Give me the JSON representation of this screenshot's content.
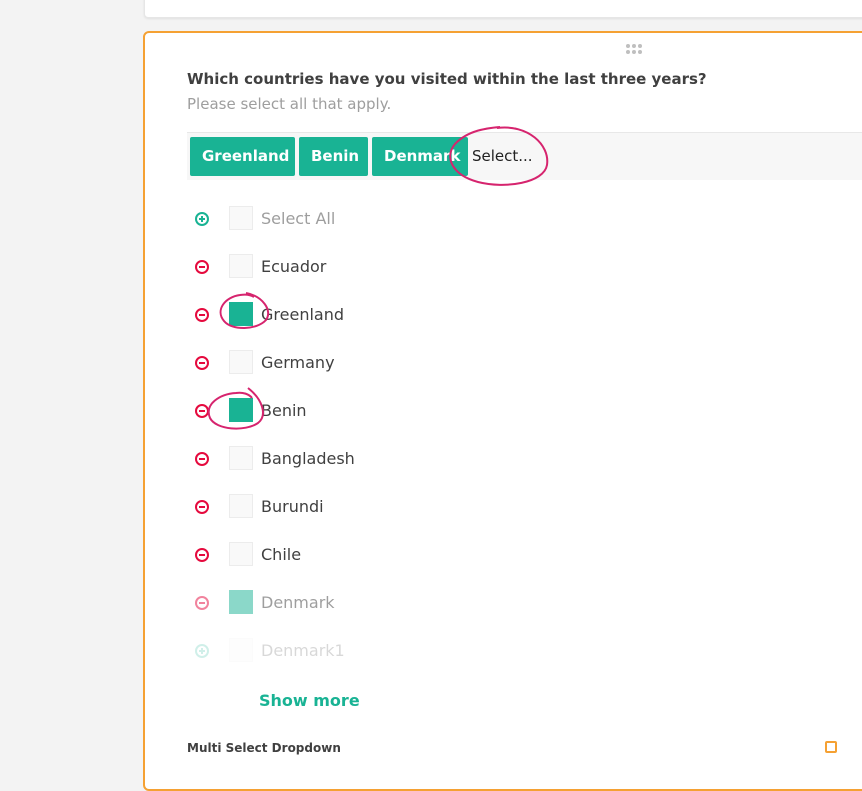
{
  "question": {
    "title": "Which countries have you visited within the last three years?",
    "description": "Please select all that apply."
  },
  "tag_box": {
    "tags": [
      "Greenland",
      "Benin",
      "Denmark"
    ],
    "placeholder": "Select..."
  },
  "options": [
    {
      "label": "Select All",
      "checked": false,
      "action": "add-icon"
    },
    {
      "label": "Ecuador",
      "checked": false,
      "action": "remove-icon"
    },
    {
      "label": "Greenland",
      "checked": true,
      "action": "remove-icon"
    },
    {
      "label": "Germany",
      "checked": false,
      "action": "remove-icon"
    },
    {
      "label": "Benin",
      "checked": true,
      "action": "remove-icon"
    },
    {
      "label": "Bangladesh",
      "checked": false,
      "action": "remove-icon"
    },
    {
      "label": "Burundi",
      "checked": false,
      "action": "remove-icon"
    },
    {
      "label": "Chile",
      "checked": false,
      "action": "remove-icon"
    },
    {
      "label": "Denmark",
      "checked": true,
      "action": "remove-icon"
    },
    {
      "label": "Denmark1",
      "checked": false,
      "action": "add-icon"
    }
  ],
  "show_more": "Show more",
  "footer": {
    "label": "Multi Select Dropdown"
  },
  "colors": {
    "accent": "#19b394",
    "remove": "#e50a3e",
    "selected_border": "#f5a133",
    "annotation": "#d6246e"
  }
}
